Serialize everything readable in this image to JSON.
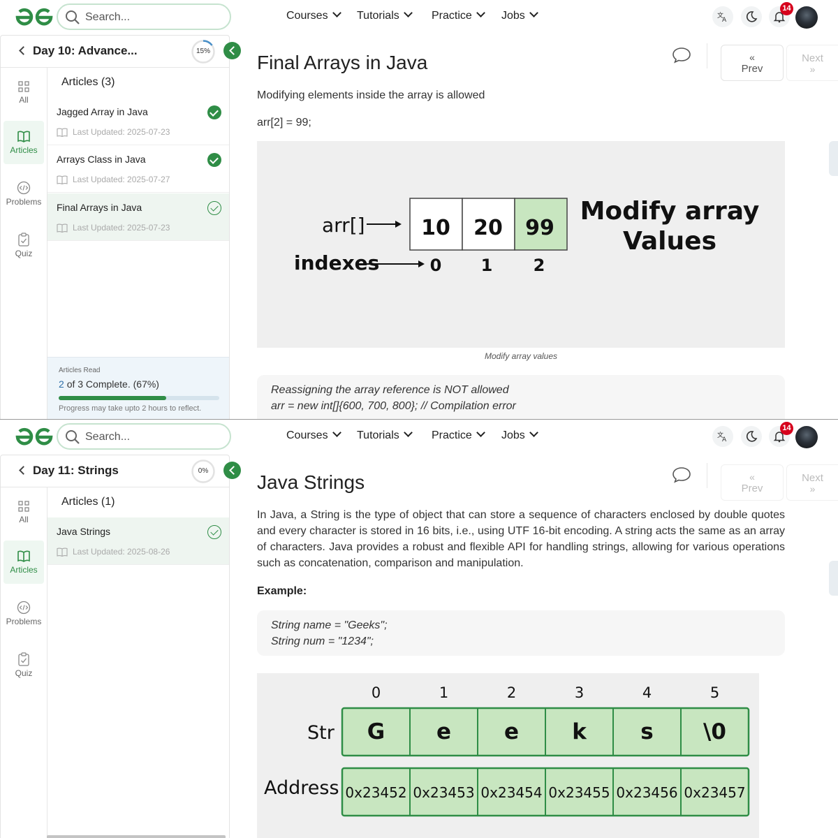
{
  "colors": {
    "brand_green": "#2f8d46",
    "notification_red": "#d6001c",
    "highlight_green": "#c8e6c0"
  },
  "header": {
    "search_placeholder": "Search...",
    "nav": [
      "Courses",
      "Tutorials",
      "Practice",
      "Jobs"
    ],
    "notification_count": "14",
    "icons": [
      "translate-icon",
      "moon-icon",
      "bell-icon"
    ]
  },
  "rail": [
    "All",
    "Articles",
    "Problems",
    "Quiz"
  ],
  "pane1": {
    "day_title": "Day 10: Advance...",
    "progress_percent": "15%",
    "progress_fraction": 0.15,
    "articles_heading": "Articles (3)",
    "articles": [
      {
        "title": "Jagged Array in Java",
        "updated": "Last Updated: 2025-07-23",
        "status": "complete"
      },
      {
        "title": "Arrays Class in Java",
        "updated": "Last Updated: 2025-07-27",
        "status": "complete"
      },
      {
        "title": "Final Arrays in Java",
        "updated": "Last Updated: 2025-07-23",
        "status": "current"
      }
    ],
    "progress_box": {
      "label": "Articles Read",
      "value_count": "2",
      "value_rest": "of 3 Complete. (67%)",
      "fraction": 0.67,
      "note": "Progress may take upto 2 hours to reflect."
    },
    "article": {
      "title": "Final Arrays in Java",
      "intro": "Modifying elements inside the array is allowed",
      "code_line": "arr[2] = 99;",
      "figure": {
        "arr_label": "arr[]",
        "indexes_label": "indexes",
        "values": [
          "10",
          "20",
          "99"
        ],
        "indexes": [
          "0",
          "1",
          "2"
        ],
        "highlight_index": 2,
        "side_title_line1": "Modify array",
        "side_title_line2": "Values"
      },
      "caption": "Modify array values",
      "code_block": [
        "Reassigning the array reference is NOT allowed",
        "arr = new int[]{600, 700, 800};  // Compilation error"
      ]
    },
    "prev_label": "Prev",
    "next_label": "Next"
  },
  "pane2": {
    "day_title": "Day 11: Strings",
    "progress_percent": "0%",
    "progress_fraction": 0,
    "articles_heading": "Articles (1)",
    "articles": [
      {
        "title": "Java Strings",
        "updated": "Last Updated: 2025-08-26",
        "status": "current"
      }
    ],
    "article": {
      "title": "Java Strings",
      "intro": "In Java, a String is the type of object that can store a sequence of characters enclosed by double quotes and every character is stored in 16 bits, i.e., using UTF 16-bit encoding. A string acts the same as an array of characters. Java provides a robust and flexible API for handling strings, allowing for various operations such as concatenation, comparison and manipulation.",
      "example_label": "Example:",
      "code_block": [
        "String name = \"Geeks\";",
        "String num = \"1234\";"
      ],
      "figure": {
        "str_label": "Str",
        "address_label": "Address",
        "indexes": [
          "0",
          "1",
          "2",
          "3",
          "4",
          "5"
        ],
        "chars": [
          "G",
          "e",
          "e",
          "k",
          "s",
          "\\0"
        ],
        "addresses": [
          "0x23452",
          "0x23453",
          "0x23454",
          "0x23455",
          "0x23456",
          "0x23457"
        ]
      }
    },
    "prev_label": "Prev",
    "next_label": "Next"
  }
}
